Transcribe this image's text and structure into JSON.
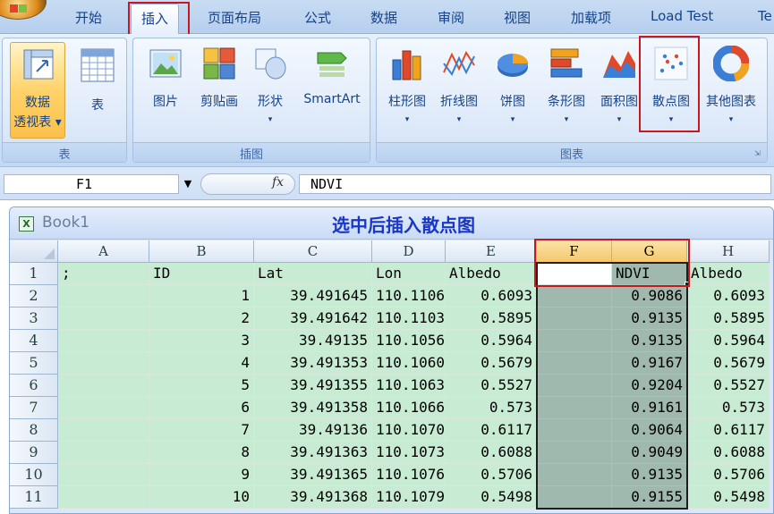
{
  "ribbon": {
    "tabs": [
      "开始",
      "插入",
      "页面布局",
      "公式",
      "数据",
      "审阅",
      "视图",
      "加载项",
      "Load Test",
      "Te"
    ],
    "active_tab": "插入",
    "groups": {
      "table": {
        "label": "表",
        "pivot_label_line1": "数据",
        "pivot_label_line2": "透视表",
        "table_label": "表"
      },
      "illustrations": {
        "label": "插图",
        "picture": "图片",
        "clipart": "剪贴画",
        "shapes": "形状",
        "smartart": "SmartArt"
      },
      "charts": {
        "label": "图表",
        "column": "柱形图",
        "line": "折线图",
        "pie": "饼图",
        "bar": "条形图",
        "area": "面积图",
        "scatter": "散点图",
        "other": "其他图表"
      }
    }
  },
  "formula_bar": {
    "name_box": "F1",
    "fx": "fx",
    "formula": "NDVI"
  },
  "workbook": {
    "name": "Book1",
    "caption": "选中后插入散点图"
  },
  "sheet": {
    "columns": [
      "A",
      "B",
      "C",
      "D",
      "E",
      "F",
      "G",
      "H"
    ],
    "rows": [
      [
        "1",
        ";",
        "ID",
        "Lat",
        "Lon",
        "Albedo",
        "",
        "NDVI",
        "Albedo",
        ""
      ],
      [
        "2",
        "",
        "1",
        "39.491645",
        "110.110643",
        "0.6093",
        "",
        "0.9086",
        "0.6093",
        ""
      ],
      [
        "3",
        "",
        "2",
        "39.491642",
        "110.110312",
        "0.5895",
        "",
        "0.9135",
        "0.5895",
        ""
      ],
      [
        "4",
        "",
        "3",
        "39.49135",
        "110.105676",
        "0.5964",
        "",
        "0.9135",
        "0.5964",
        ""
      ],
      [
        "5",
        "",
        "4",
        "39.491353",
        "110.106007",
        "0.5679",
        "",
        "0.9167",
        "0.5679",
        ""
      ],
      [
        "6",
        "",
        "5",
        "39.491355",
        "110.106339",
        "0.5527",
        "",
        "0.9204",
        "0.5527",
        ""
      ],
      [
        "7",
        "",
        "6",
        "39.491358",
        "110.10667",
        "0.573",
        "",
        "0.9161",
        "0.573",
        ""
      ],
      [
        "8",
        "",
        "7",
        "39.49136",
        "110.107001",
        "0.6117",
        "",
        "0.9064",
        "0.6117",
        ""
      ],
      [
        "9",
        "",
        "8",
        "39.491363",
        "110.107333",
        "0.6088",
        "",
        "0.9049",
        "0.6088",
        ""
      ],
      [
        "10",
        "",
        "9",
        "39.491365",
        "110.107664",
        "0.5706",
        "",
        "0.9135",
        "0.5706",
        ""
      ],
      [
        "11",
        "",
        "10",
        "39.491368",
        "110.107996",
        "0.5498",
        "",
        "0.9155",
        "0.5498",
        ""
      ]
    ],
    "selected_columns": [
      "F",
      "G"
    ]
  },
  "colors": {
    "highlight_red": "#c8171d",
    "cell_green": "#c8ebd3",
    "selection_gray": "#9fb9ae",
    "caption_blue": "#1a36c7"
  }
}
